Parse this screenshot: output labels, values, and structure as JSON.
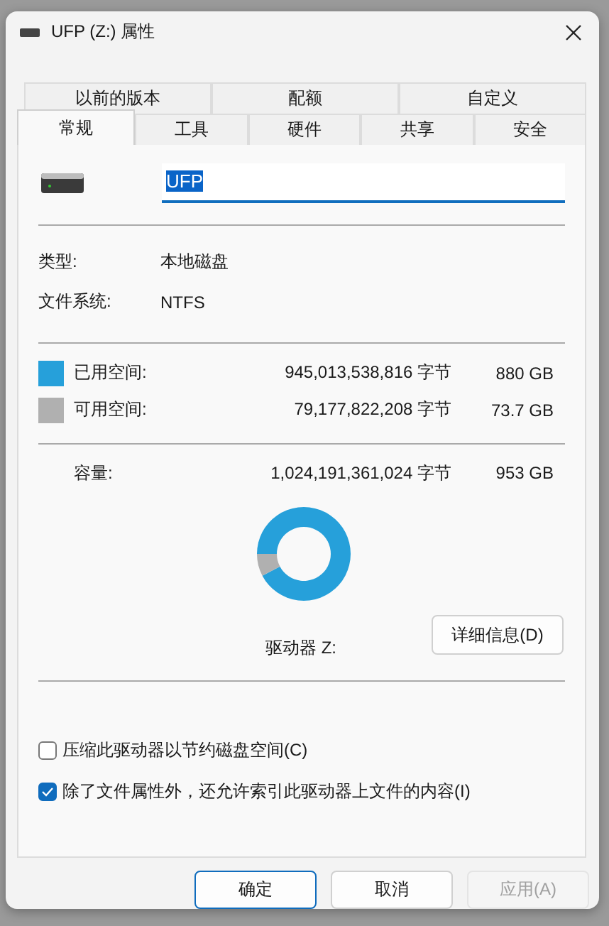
{
  "window": {
    "title": "UFP (Z:) 属性"
  },
  "tab_rows": [
    {
      "tabs": [
        {
          "label": "以前的版本",
          "selected": false
        },
        {
          "label": "配额",
          "selected": false
        },
        {
          "label": "自定义",
          "selected": false
        }
      ]
    },
    {
      "tabs": [
        {
          "label": "常规",
          "selected": true
        },
        {
          "label": "工具",
          "selected": false
        },
        {
          "label": "硬件",
          "selected": false
        },
        {
          "label": "共享",
          "selected": false
        },
        {
          "label": "安全",
          "selected": false
        }
      ]
    }
  ],
  "name_field": {
    "value": "UFP",
    "text_selected": true
  },
  "info": [
    {
      "label": "类型:",
      "value": "本地磁盘"
    },
    {
      "label": "文件系统:",
      "value": "NTFS"
    }
  ],
  "spaces": [
    {
      "label": "已用空间:",
      "bytes": "945,013,538,816 字节",
      "size": "880 GB",
      "color": "#26a0da"
    },
    {
      "label": "可用空间:",
      "bytes": "79,177,822,208 字节",
      "size": "73.7 GB",
      "color": "#b0b0b0"
    }
  ],
  "capacity": {
    "label": "容量:",
    "bytes": "1,024,191,361,024 字节",
    "size": "953 GB"
  },
  "chart_data": {
    "type": "donut",
    "values": [
      92.3,
      7.7
    ]
  },
  "drive_label": "驱动器 Z:",
  "details_button": "详细信息(D)",
  "options": [
    {
      "label": "压缩此驱动器以节约磁盘空间(C)",
      "checked": false
    },
    {
      "label": "除了文件属性外，还允许索引此驱动器上文件的内容(I)",
      "checked": true
    }
  ],
  "buttons": [
    {
      "label": "确定",
      "kind": "default",
      "disabled": false
    },
    {
      "label": "取消",
      "kind": "normal",
      "disabled": false
    },
    {
      "label": "应用(A)",
      "kind": "normal",
      "disabled": true
    }
  ]
}
